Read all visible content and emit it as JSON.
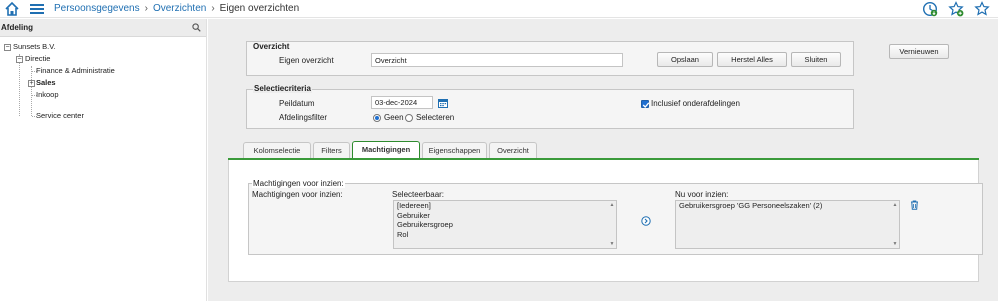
{
  "breadcrumb": {
    "items": [
      "Persoonsgegevens",
      "Overzichten"
    ],
    "current": "Eigen overzichten",
    "separator": "›"
  },
  "top_icons": [
    "home-icon",
    "menu-icon",
    "clock-download-icon",
    "star-add-icon",
    "star-icon"
  ],
  "sidebar": {
    "title": "Afdeling",
    "tree": [
      {
        "label": "Sunsets B.V.",
        "expander": "−"
      },
      {
        "label": "Directie",
        "expander": "−"
      },
      {
        "label": "Finance & Administratie"
      },
      {
        "label": "Sales",
        "expander": "+"
      },
      {
        "label": "Inkoop"
      },
      {
        "label": "Service center"
      }
    ]
  },
  "overzicht": {
    "title": "Overzicht",
    "label": "Eigen overzicht",
    "value": "Overzicht",
    "buttons": {
      "save": "Opslaan",
      "reset": "Herstel Alles",
      "close": "Sluiten"
    }
  },
  "refresh_button": "Vernieuwen",
  "selectie": {
    "title": "Selectiecriteria",
    "peildatum_label": "Peildatum",
    "peildatum_value": "03-dec-2024",
    "filter_label": "Afdelingsfilter",
    "radio_none": "Geen",
    "radio_select": "Selecteren",
    "radio_selected": "Geen",
    "include_label": "Inclusief onderafdelingen",
    "include_checked": true
  },
  "tabs": [
    "Kolomselectie",
    "Filters",
    "Machtigingen",
    "Eigenschappen",
    "Overzicht"
  ],
  "active_tab": "Machtigingen",
  "machtigingen": {
    "group_title": "Machtigingen voor inzien:",
    "row_label": "Machtigingen voor inzien:",
    "selectable_label": "Selecteerbaar:",
    "selectable_items": [
      "[Iedereen]",
      "Gebruiker",
      "Gebruikersgroep",
      "Rol"
    ],
    "current_label": "Nu voor inzien:",
    "current_items": [
      "Gebruikersgroep 'GG Personeelszaken' (2)"
    ]
  },
  "colors": {
    "accent": "#1f6fb2",
    "tab_active": "#3a9a3a",
    "icon_green": "#2e8b2e"
  }
}
